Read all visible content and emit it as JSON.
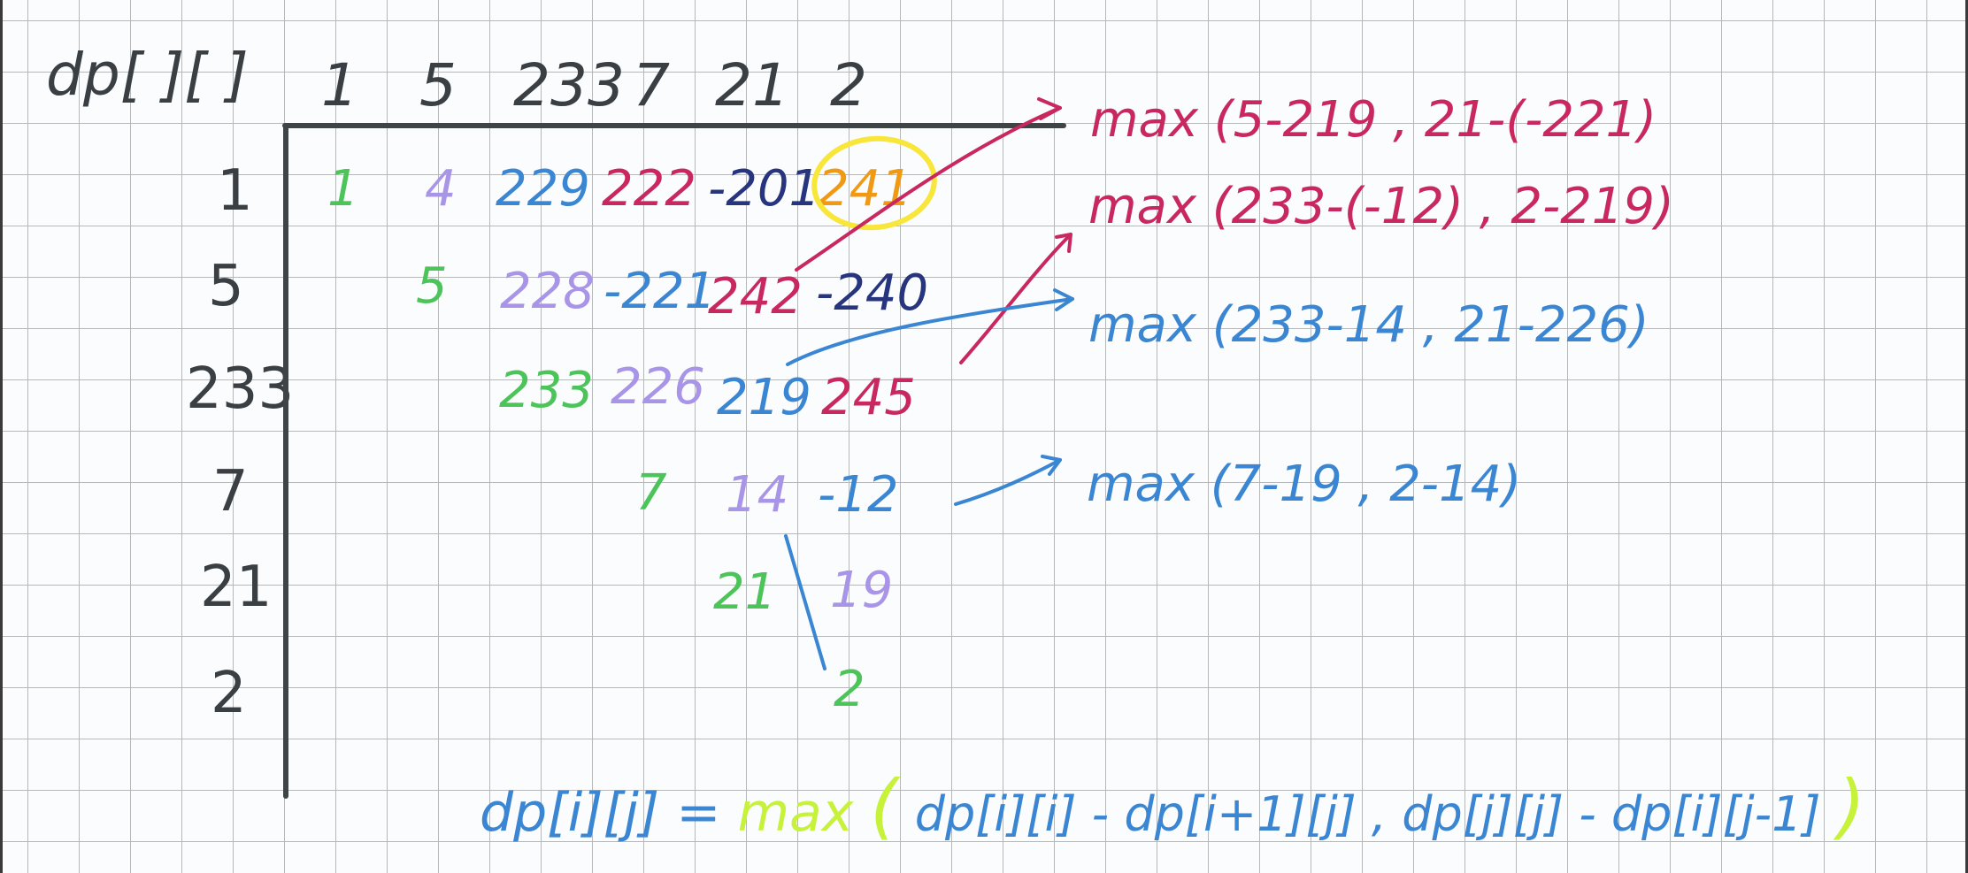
{
  "table": {
    "label": "dp[ ][ ]",
    "column_headers": [
      "1",
      "5",
      "233",
      "7",
      "21",
      "2"
    ],
    "row_headers": [
      "1",
      "5",
      "233",
      "7",
      "21",
      "2"
    ],
    "rows": [
      [
        "1",
        "4",
        "229",
        "222",
        "-201",
        "241"
      ],
      [
        "5",
        "228",
        "-221",
        "242",
        "-240"
      ],
      [
        "233",
        "226",
        "219",
        "245"
      ],
      [
        "7",
        "14",
        "-12"
      ],
      [
        "21",
        "19"
      ],
      [
        "2"
      ]
    ]
  },
  "annotations": {
    "row1": "max (5-219 , 21-(-221)",
    "row2": "max (233-(-12) , 2-219)",
    "row3": "max (233-14 , 21-226)",
    "row4": "max (7-19 , 2-14)"
  },
  "recurrence": {
    "lhs": "dp[i][j] =",
    "func": "max",
    "open": "(",
    "args": "dp[i][i] - dp[i+1][j] , dp[j][j] - dp[i][j-1]",
    "close": ")"
  },
  "colors": {
    "grid": "#a9bad3",
    "axis": "#3f4446",
    "diagonal": "#4cc45a",
    "second_diagonal": "#a995e8",
    "third_diagonal": "#3a86d2",
    "fourth_diagonal": "#c8285e",
    "fifth_diagonal": "#27357f",
    "result": "#f09a14",
    "highlight": "#f8e63a",
    "max_word": "#c6f23a"
  }
}
